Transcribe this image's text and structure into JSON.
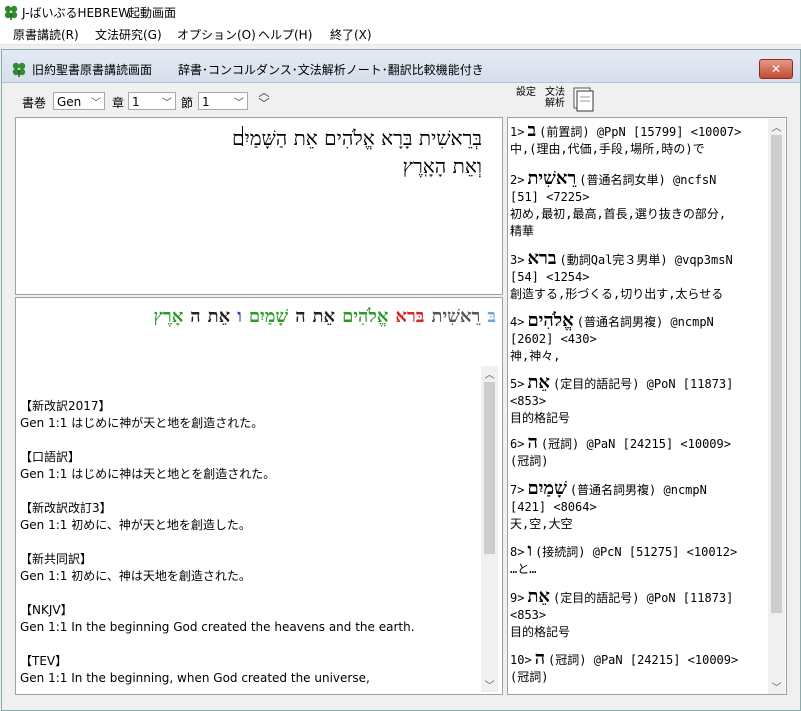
{
  "app": {
    "title": "J-ばいぶるHEBREW",
    "subtitle": "起動画面"
  },
  "menu": [
    "原書講読(R)",
    "文法研究(G)",
    "オプション(O)",
    "ヘルプ(H)",
    "終了(X)"
  ],
  "window": {
    "title": "旧約聖書原書講読画面",
    "subtitle": "辞書･コンコルダンス･文法解析ノート･翻訳比較機能付き",
    "close_label": "✕"
  },
  "nav": {
    "book_label": "書巻",
    "book_value": "Gen",
    "chapter_label": "章",
    "chapter_value": "1",
    "verse_label": "節",
    "verse_value": "1"
  },
  "tools": {
    "settings_label": "設定",
    "grammar_label": "文法解析"
  },
  "hebrew_text": {
    "line1": "בְּרֵאשִׁית בָּרָא אֱלֹהִים אֵת הַשָּׁמַיִם",
    "line2": "וְאֵת הָאָֽרֶץ"
  },
  "word_strip": [
    {
      "text": "בּ",
      "color": "#6fa8dc"
    },
    {
      "text": "רֵאשִׁית",
      "color": "#555555"
    },
    {
      "text": "בּרא",
      "color": "#e02020"
    },
    {
      "text": "אֱלֹהִים",
      "color": "#2a9a2a"
    },
    {
      "text": "אֵת",
      "color": "#222222"
    },
    {
      "text": "ה",
      "color": "#222222"
    },
    {
      "text": "שָׁמַיִם",
      "color": "#2a9a2a"
    },
    {
      "text": "ו",
      "color": "#2040c0"
    },
    {
      "text": "אֵת",
      "color": "#222222"
    },
    {
      "text": "ה",
      "color": "#222222"
    },
    {
      "text": "אָרֶץ",
      "color": "#2a9a2a"
    }
  ],
  "translations": [
    {
      "name": "【新改訳2017】",
      "text": "Gen 1:1 はじめに神が天と地を創造された。"
    },
    {
      "name": "【口語訳】",
      "text": "Gen 1:1 はじめに神は天と地とを創造された。"
    },
    {
      "name": "【新改訳改訂3】",
      "text": "Gen 1:1 初めに、神が天と地を創造した。"
    },
    {
      "name": "【新共同訳】",
      "text": "Gen 1:1 初めに、神は天地を創造された。"
    },
    {
      "name": "【NKJV】",
      "text": "Gen 1:1 In the beginning God created the heavens and the earth."
    },
    {
      "name": "【TEV】",
      "text": "Gen 1:1 In the beginning, when God created the universe,"
    }
  ],
  "dictionary": [
    {
      "num": "1>",
      "word": "ב",
      "desc": "(前置詞) @PpN [15799] <10007>",
      "lines": [
        "中,(理由,代価,手段,場所,時の)で"
      ]
    },
    {
      "num": "2>",
      "word": "רֵאשִׁית",
      "desc": "(普通名詞女単) @ncfsN",
      "lines": [
        "[51] <7225>",
        "初め,最初,最高,首長,選り抜きの部分,",
        "精華"
      ]
    },
    {
      "num": "3>",
      "word": "ברא",
      "desc": "(動詞Qal完３男単) @vqp3msN",
      "lines": [
        "[54] <1254>",
        "創造する,形づくる,切り出す,太らせる"
      ]
    },
    {
      "num": "4>",
      "word": "אֱלֹהִים",
      "desc": "(普通名詞男複) @ncmpN",
      "lines": [
        "[2602] <430>",
        "神,神々,"
      ]
    },
    {
      "num": "5>",
      "word": "אֵת",
      "desc": "(定目的語記号) @PoN [11873]",
      "lines": [
        "<853>",
        "目的格記号"
      ]
    },
    {
      "num": "6>",
      "word": "ה",
      "desc": "(冠詞) @PaN [24215] <10009>",
      "lines": [
        "(冠詞)"
      ]
    },
    {
      "num": "7>",
      "word": "שָׁמַיִם",
      "desc": "(普通名詞男複) @ncmpN",
      "lines": [
        "[421] <8064>",
        "天,空,大空"
      ]
    },
    {
      "num": "8>",
      "word": "ו",
      "desc": "(接続詞) @PcN [51275] <10012>",
      "lines": [
        "…と…"
      ]
    },
    {
      "num": "9>",
      "word": "אֵת",
      "desc": "(定目的語記号) @PoN [11873]",
      "lines": [
        "<853>",
        "目的格記号"
      ]
    },
    {
      "num": "10>",
      "word": "ה",
      "desc": "(冠詞) @PaN [24215] <10009>",
      "lines": [
        "(冠詞)"
      ]
    }
  ]
}
